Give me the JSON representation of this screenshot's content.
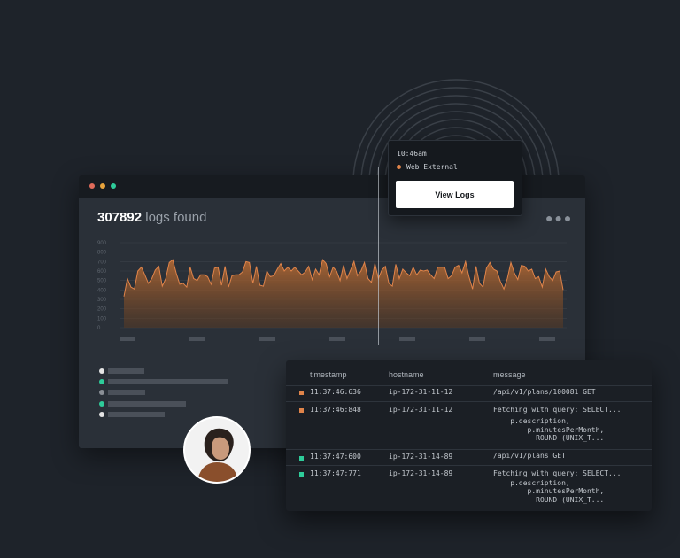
{
  "colors": {
    "background": "#1e232a",
    "window": "#2a3038",
    "titlebar": "#171b20",
    "accent_orange": "#e0844a",
    "accent_green": "#2ecc9a",
    "dot_red": "#e06b5a",
    "dot_orange": "#e8a33c"
  },
  "logs": {
    "count": "307892",
    "suffix": "logs found",
    "more_icon": "ellipsis-icon"
  },
  "chart_data": {
    "type": "area",
    "ylim": [
      0,
      900
    ],
    "y_ticks": [
      "900",
      "800",
      "700",
      "600",
      "500",
      "400",
      "300",
      "200",
      "100",
      "0"
    ],
    "series": [
      {
        "values": [
          330,
          520,
          430,
          410,
          600,
          640,
          560,
          470,
          520,
          610,
          650,
          440,
          520,
          690,
          720,
          580,
          460,
          470,
          430,
          640,
          520,
          500,
          560,
          560,
          540,
          460,
          630,
          640,
          450,
          650,
          430,
          550,
          560,
          560,
          590,
          700,
          690,
          470,
          650,
          450,
          440,
          600,
          540,
          550,
          620,
          680,
          600,
          640,
          600,
          640,
          600,
          560,
          590,
          650,
          510,
          620,
          560,
          720,
          680,
          540,
          640,
          600,
          500,
          660,
          520,
          610,
          700,
          550,
          600,
          690,
          520,
          480,
          680,
          520,
          610,
          650,
          470,
          440,
          670,
          520,
          620,
          580,
          550,
          640,
          560,
          610,
          600,
          610,
          560,
          520,
          640,
          640,
          640,
          520,
          550,
          640,
          660,
          580,
          700,
          540,
          410,
          650,
          470,
          430,
          630,
          690,
          620,
          600,
          490,
          410,
          520,
          690,
          580,
          510,
          660,
          650,
          600,
          620,
          520,
          540,
          430,
          620,
          540,
          500,
          590,
          600,
          400
        ]
      }
    ]
  },
  "status_list": [
    {
      "dot": "#e4e4e4"
    },
    {
      "dot": "#2ecc9a"
    },
    {
      "dot": "#8a8f96"
    },
    {
      "dot": "#2ecc9a"
    },
    {
      "dot": "#e4e4e4"
    }
  ],
  "popover": {
    "time": "10:46am",
    "host": "Web External",
    "button_label": "View Logs"
  },
  "table": {
    "headers": {
      "timestamp": "timestamp",
      "hostname": "hostname",
      "message": "message"
    },
    "rows": [
      {
        "timestamp": "11:37:46:636",
        "hostname": "ip-172-31-11-12",
        "message_lines": [
          "/api/v1/plans/100081 GET"
        ],
        "status": "#e0844a"
      },
      {
        "timestamp": "11:37:46:848",
        "hostname": "ip-172-31-11-12",
        "message_lines": [
          "Fetching with query: SELECT...",
          "    p.description,",
          "        p.minutesPerMonth,",
          "          ROUND (UNIX_T..."
        ],
        "status": "#e0844a"
      },
      {
        "timestamp": "11:37:47:600",
        "hostname": "ip-172-31-14-89",
        "message_lines": [
          "/api/v1/plans GET"
        ],
        "status": "#2ecc9a"
      },
      {
        "timestamp": "11:37:47:771",
        "hostname": "ip-172-31-14-89",
        "message_lines": [
          "Fetching with query: SELECT...",
          "    p.description,",
          "        p.minutesPerMonth,",
          "          ROUND (UNIX_T..."
        ],
        "status": "#2ecc9a"
      }
    ]
  },
  "avatar": {
    "icon": "user-avatar"
  }
}
